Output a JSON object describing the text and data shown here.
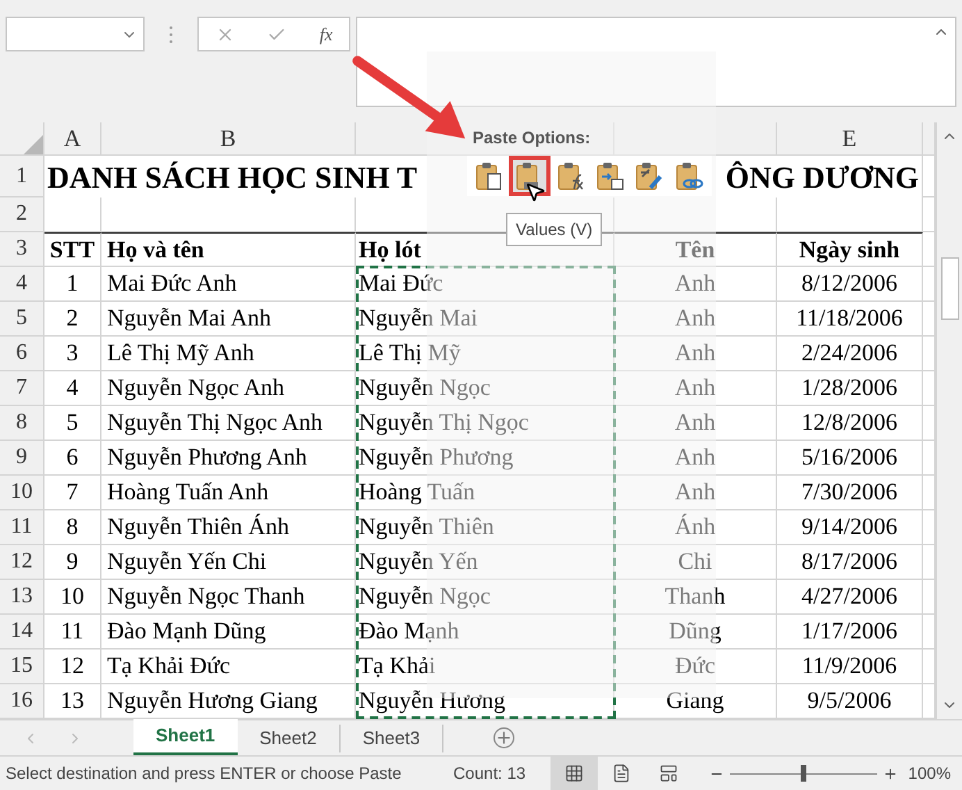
{
  "formula_bar": {
    "fx": "fx"
  },
  "columns_left": [
    "A",
    "B"
  ],
  "columns_right": [
    "E"
  ],
  "title": {
    "row": "1",
    "left": "DANH SÁCH HỌC SINH T",
    "right": "ÔNG DƯƠNG"
  },
  "blank_row": "2",
  "header": {
    "row": "3",
    "cells": [
      "STT",
      "Họ và tên",
      "Họ lót",
      "Tên",
      "Ngày sinh"
    ]
  },
  "rows": [
    {
      "row": "4",
      "cells": [
        "1",
        "Mai Đức Anh",
        "Mai Đức",
        "Anh",
        "8/12/2006"
      ]
    },
    {
      "row": "5",
      "cells": [
        "2",
        "Nguyễn Mai Anh",
        "Nguyễn Mai",
        "Anh",
        "11/18/2006"
      ]
    },
    {
      "row": "6",
      "cells": [
        "3",
        "Lê Thị Mỹ Anh",
        "Lê Thị Mỹ",
        "Anh",
        "2/24/2006"
      ]
    },
    {
      "row": "7",
      "cells": [
        "4",
        "Nguyễn Ngọc Anh",
        "Nguyễn Ngọc",
        "Anh",
        "1/28/2006"
      ]
    },
    {
      "row": "8",
      "cells": [
        "5",
        "Nguyễn Thị Ngọc Anh",
        "Nguyễn Thị Ngọc",
        "Anh",
        "12/8/2006"
      ]
    },
    {
      "row": "9",
      "cells": [
        "6",
        "Nguyễn Phương Anh",
        "Nguyễn Phương",
        "Anh",
        "5/16/2006"
      ]
    },
    {
      "row": "10",
      "cells": [
        "7",
        "Hoàng Tuấn Anh",
        "Hoàng Tuấn",
        "Anh",
        "7/30/2006"
      ]
    },
    {
      "row": "11",
      "cells": [
        "8",
        "Nguyễn Thiên Ánh",
        "Nguyễn Thiên",
        "Ánh",
        "9/14/2006"
      ]
    },
    {
      "row": "12",
      "cells": [
        "9",
        "Nguyễn Yến Chi",
        "Nguyễn Yến",
        "Chi",
        "8/17/2006"
      ]
    },
    {
      "row": "13",
      "cells": [
        "10",
        "Nguyễn Ngọc Thanh",
        "Nguyễn Ngọc",
        "Thanh",
        "4/27/2006"
      ]
    },
    {
      "row": "14",
      "cells": [
        "11",
        "Đào Mạnh Dũng",
        "Đào Mạnh",
        "Dũng",
        "1/17/2006"
      ]
    },
    {
      "row": "15",
      "cells": [
        "12",
        "Tạ Khải Đức",
        "Tạ Khải",
        "Đức",
        "11/9/2006"
      ]
    },
    {
      "row": "16",
      "cells": [
        "13",
        "Nguyễn Hương Giang",
        "Nguyễn Hương",
        "Giang",
        "9/5/2006"
      ]
    }
  ],
  "paste_options": {
    "title": "Paste Options:",
    "tooltip": "Values (V)",
    "options": [
      {
        "kind": "paste",
        "selected": false
      },
      {
        "kind": "values",
        "selected": true
      },
      {
        "kind": "formulas",
        "selected": false
      },
      {
        "kind": "transpose",
        "selected": false
      },
      {
        "kind": "formatting",
        "selected": false
      },
      {
        "kind": "link",
        "selected": false
      }
    ]
  },
  "sheet_tabs": [
    {
      "label": "Sheet1",
      "selected": true
    },
    {
      "label": "Sheet2",
      "selected": false
    },
    {
      "label": "Sheet3",
      "selected": false
    }
  ],
  "status_bar": {
    "message": "Select destination and press ENTER or choose Paste",
    "count": "Count: 13",
    "views": [
      {
        "kind": "normal",
        "selected": true
      },
      {
        "kind": "page_layout",
        "selected": false
      },
      {
        "kind": "page_break",
        "selected": false
      }
    ],
    "zoom": {
      "level": 0.5,
      "reading": "100%"
    }
  }
}
